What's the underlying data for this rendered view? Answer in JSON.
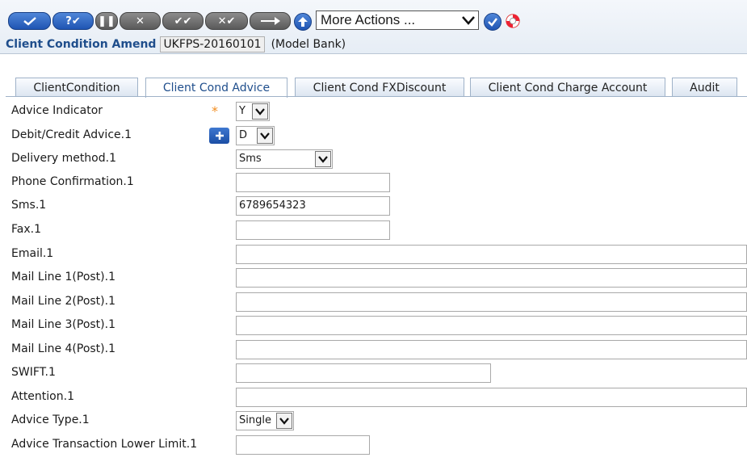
{
  "toolbar": {
    "buttons": [
      {
        "icon": "validate-icon"
      },
      {
        "icon": "help-validate-icon"
      },
      {
        "icon": "hold-icon"
      },
      {
        "icon": "delete-icon"
      },
      {
        "icon": "authorise-icon"
      },
      {
        "icon": "reverse-icon"
      },
      {
        "icon": "next-icon"
      },
      {
        "icon": "upload-icon"
      }
    ],
    "more_actions": "More Actions ...",
    "go_icon": "go-check-icon",
    "help_icon": "lifebuoy-icon"
  },
  "record": {
    "title": "Client Condition Amend",
    "id": "UKFPS-20160101",
    "company": "(Model Bank)"
  },
  "tabs": [
    {
      "label": "ClientCondition"
    },
    {
      "label": "Client Cond Advice"
    },
    {
      "label": "Client Cond FXDiscount"
    },
    {
      "label": "Client Cond Charge Account"
    },
    {
      "label": "Audit"
    }
  ],
  "active_tab": "Client Cond Advice",
  "form": {
    "advice_indicator": {
      "label": "Advice Indicator",
      "mandatory": "*",
      "value": "Y"
    },
    "debit_credit_advice": {
      "label": "Debit/Credit Advice.1",
      "value": "D"
    },
    "delivery_method": {
      "label": "Delivery method.1",
      "value": "Sms"
    },
    "phone_confirmation": {
      "label": "Phone Confirmation.1",
      "value": ""
    },
    "sms": {
      "label": "Sms.1",
      "value": "6789654323"
    },
    "fax": {
      "label": "Fax.1",
      "value": ""
    },
    "email": {
      "label": "Email.1",
      "value": ""
    },
    "mail_line_1": {
      "label": "Mail Line 1(Post).1",
      "value": ""
    },
    "mail_line_2": {
      "label": "Mail Line 2(Post).1",
      "value": ""
    },
    "mail_line_3": {
      "label": "Mail Line 3(Post).1",
      "value": ""
    },
    "mail_line_4": {
      "label": "Mail Line 4(Post).1",
      "value": ""
    },
    "swift": {
      "label": "SWIFT.1",
      "value": ""
    },
    "attention": {
      "label": "Attention.1",
      "value": ""
    },
    "advice_type": {
      "label": "Advice Type.1",
      "value": "Single"
    },
    "advice_txn_lower_limit": {
      "label": "Advice Transaction Lower Limit.1",
      "value": ""
    }
  },
  "colors": {
    "accent": "#1f4e8c",
    "mandatory": "#f28c1e",
    "button_blue": "#2a62c0"
  }
}
